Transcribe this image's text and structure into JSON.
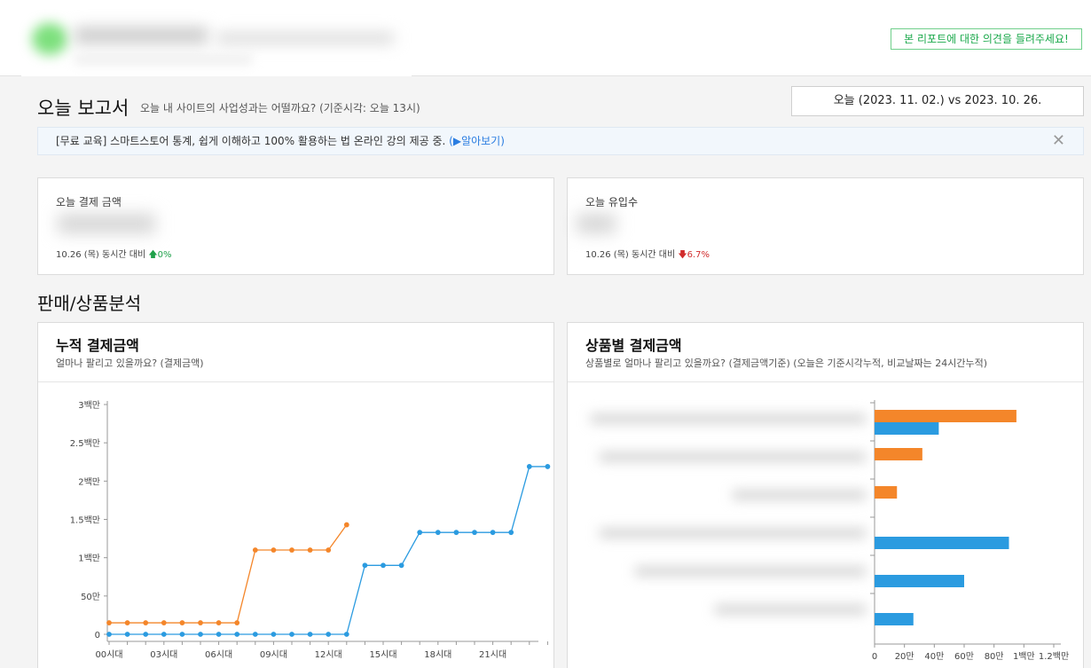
{
  "header": {
    "feedback_button": "본 리포트에 대한 의견을 들려주세요!"
  },
  "report": {
    "title": "오늘 보고서",
    "subtitle": "오늘 내 사이트의 사업성과는 어떨까요? (기준시각: 오늘 13시)",
    "date_compare": "오늘 (2023. 11. 02.) vs 2023. 10. 26."
  },
  "notice": {
    "text": "[무료 교육] 스마트스토어 통계, 쉽게 이해하고 100% 활용하는 법 온라인 강의 제공 중.",
    "link": "(▶알아보기)",
    "close": "✕"
  },
  "stats": [
    {
      "label": "오늘 결제 금액",
      "compare": "10.26 (목) 동시간 대비",
      "arrow": "🡅",
      "change": "0%",
      "direction": "up"
    },
    {
      "label": "오늘 유입수",
      "compare": "10.26 (목) 동시간 대비",
      "arrow": "🡇",
      "change": "6.7%",
      "direction": "down"
    }
  ],
  "section": {
    "title": "판매/상품분석"
  },
  "cumulative_card": {
    "title": "누적 결제금액",
    "subtitle": "얼마나 팔리고 있을까요? (결제금액)"
  },
  "product_card": {
    "title": "상품별 결제금액",
    "subtitle": "상품별로 얼마나 팔리고 있을까요? (결제금액기준) (오늘은 기준시각누적, 비교날짜는 24시간누적)"
  },
  "colors": {
    "today": "#2b9be0",
    "compare": "#f4862a",
    "accent_green": "#19a84a"
  },
  "chart_data": [
    {
      "type": "line",
      "x_tick_labels": [
        "00시대",
        "03시대",
        "06시대",
        "09시대",
        "12시대",
        "15시대",
        "18시대",
        "21시대"
      ],
      "y_tick_labels": [
        "0",
        "50만",
        "1백만",
        "1.5백만",
        "2백만",
        "2.5백만",
        "3백만"
      ],
      "ylim": [
        0,
        3000000
      ],
      "series": [
        {
          "color": "#f4862a",
          "values": [
            150000,
            150000,
            150000,
            150000,
            150000,
            150000,
            150000,
            150000,
            1100000,
            1100000,
            1100000,
            1100000,
            1100000,
            1430000
          ]
        },
        {
          "color": "#2b9be0",
          "values": [
            0,
            0,
            0,
            0,
            0,
            0,
            0,
            0,
            0,
            0,
            0,
            0,
            0,
            0,
            900000,
            900000,
            900000,
            1330000,
            1330000,
            1330000,
            1330000,
            1330000,
            1330000,
            2190000,
            2190000
          ]
        }
      ]
    },
    {
      "type": "bar",
      "orientation": "horizontal",
      "x_tick_labels": [
        "0",
        "20만",
        "40만",
        "60만",
        "80만",
        "1백만",
        "1.2백만"
      ],
      "xlim": [
        0,
        1200000
      ],
      "series": [
        {
          "color": "#f4862a",
          "values": [
            950000,
            320000,
            150000,
            0,
            0,
            0
          ]
        },
        {
          "color": "#2b9be0",
          "values": [
            430000,
            0,
            0,
            900000,
            600000,
            260000
          ]
        }
      ]
    }
  ]
}
